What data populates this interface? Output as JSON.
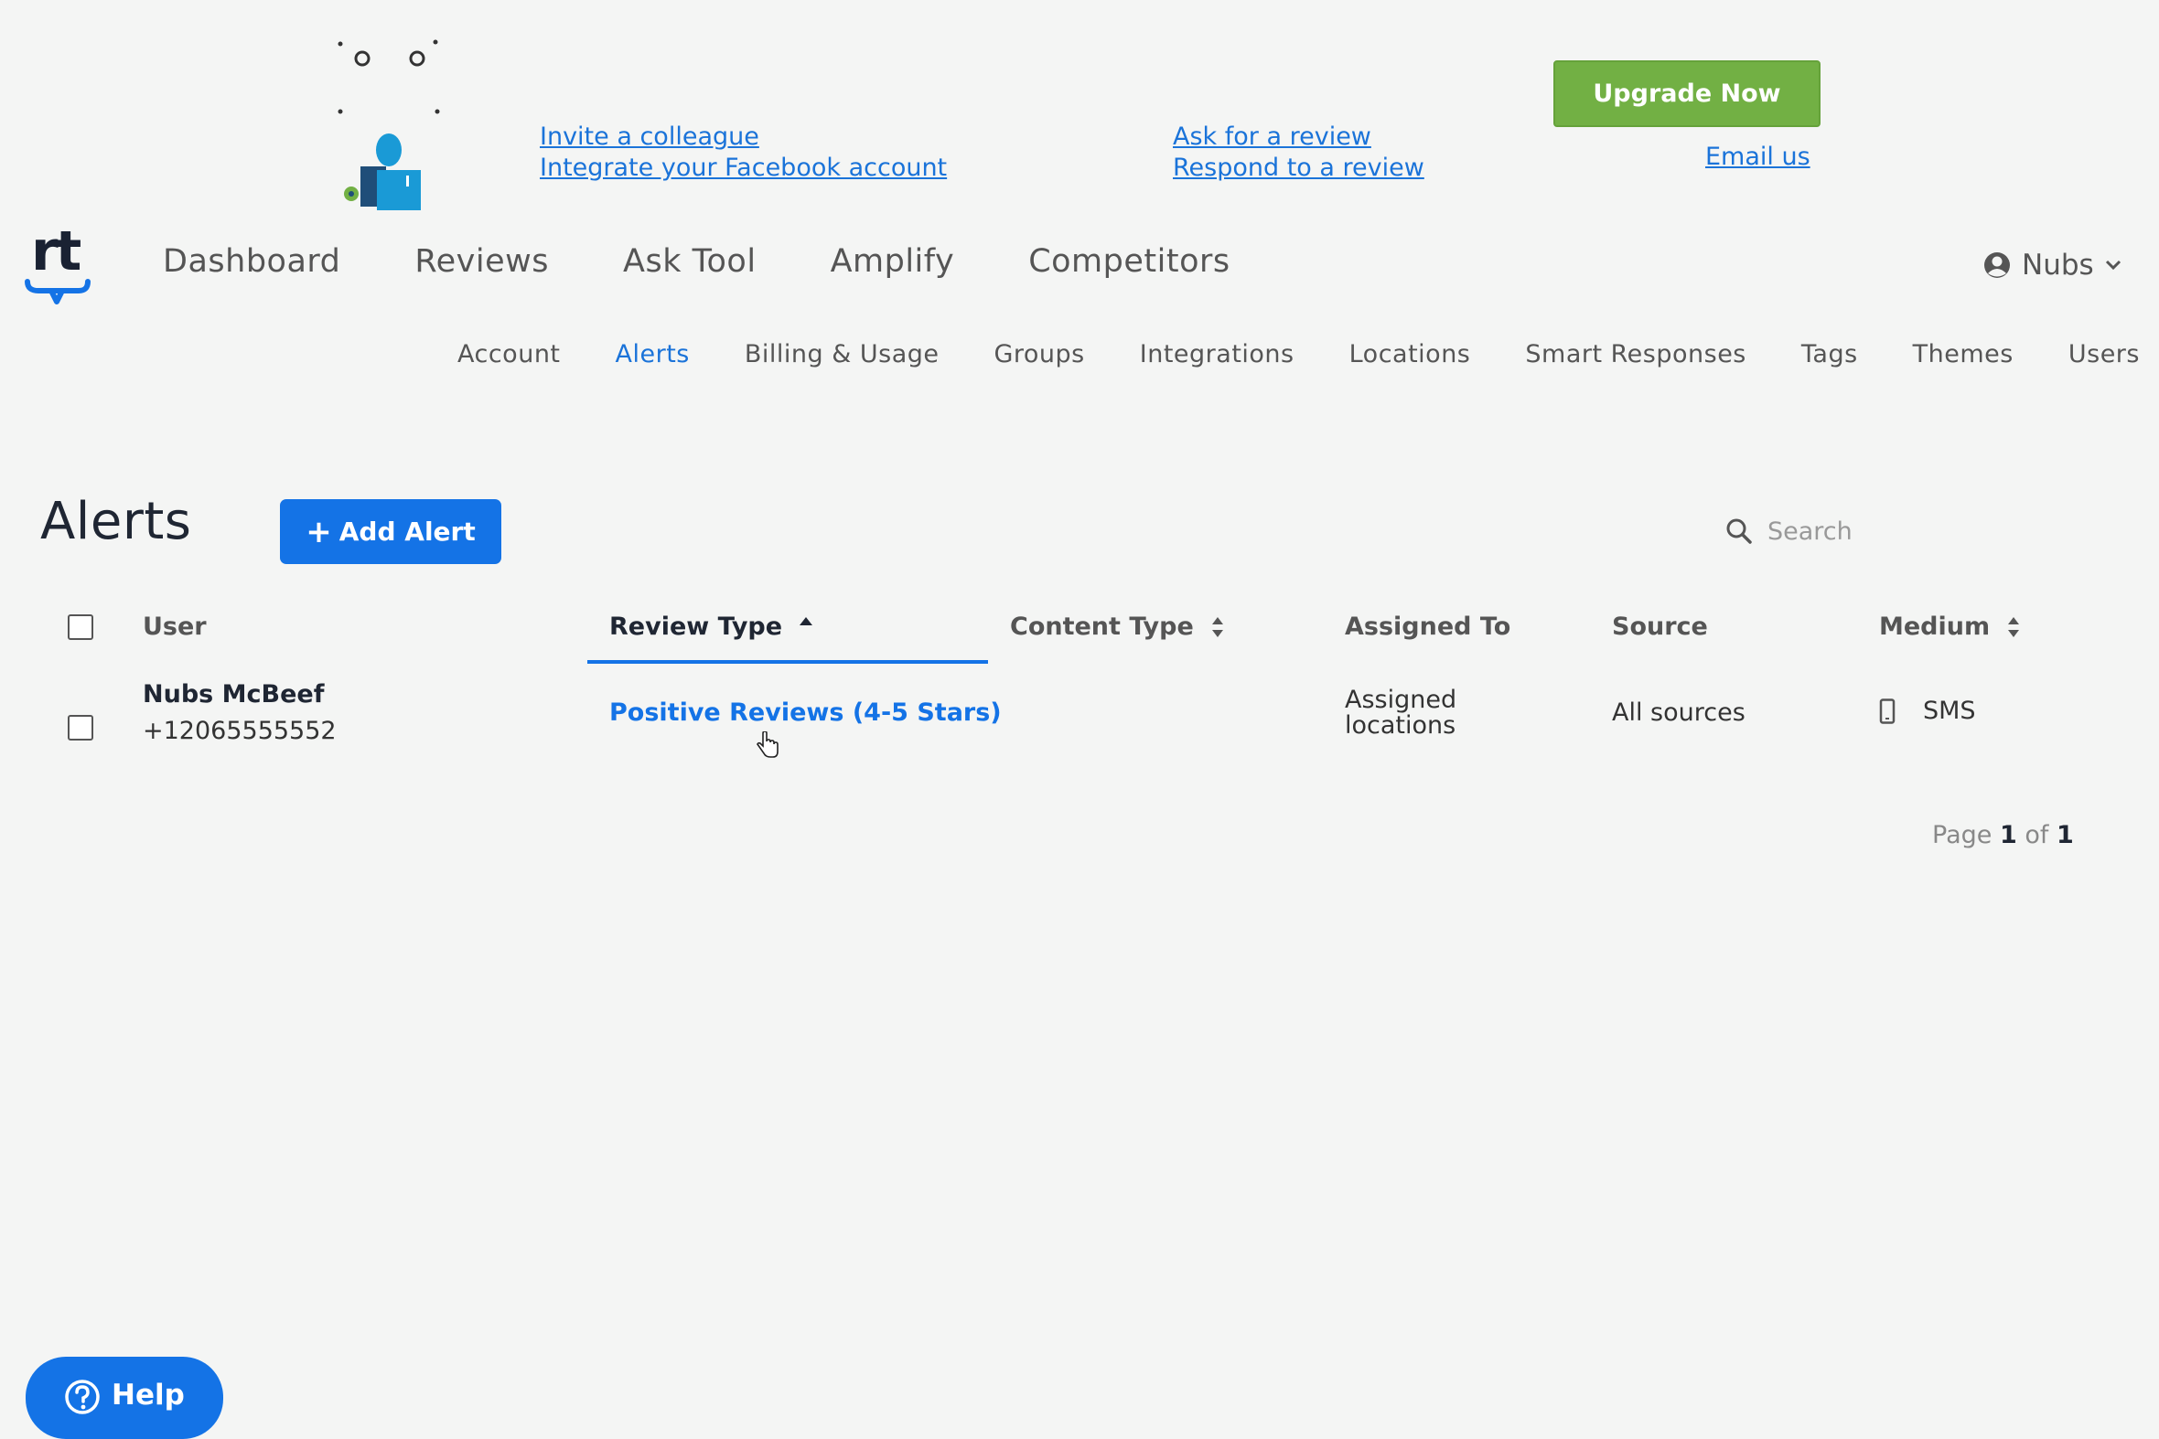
{
  "promo": {
    "left_links": [
      "Invite a colleague",
      "Integrate your Facebook account"
    ],
    "middle_links": [
      "Ask for a review",
      "Respond to a review"
    ],
    "upgrade_label": "Upgrade Now",
    "email_label": "Email us"
  },
  "logo": {
    "text": "rt"
  },
  "main_nav": {
    "items": [
      "Dashboard",
      "Reviews",
      "Ask Tool",
      "Amplify",
      "Competitors"
    ]
  },
  "user_menu": {
    "name": "Nubs"
  },
  "sub_nav": {
    "items": [
      "Account",
      "Alerts",
      "Billing & Usage",
      "Groups",
      "Integrations",
      "Locations",
      "Smart Responses",
      "Tags",
      "Themes",
      "Users"
    ],
    "active": "Alerts"
  },
  "page": {
    "title": "Alerts",
    "add_button_label": "Add Alert",
    "add_button_icon": "+",
    "search_placeholder": "Search"
  },
  "table": {
    "columns": {
      "user": "User",
      "review_type": "Review Type",
      "content_type": "Content Type",
      "assigned_to": "Assigned To",
      "source": "Source",
      "medium": "Medium"
    },
    "sorted_column": "Review Type",
    "rows": [
      {
        "user_name": "Nubs McBeef",
        "user_phone": "+12065555552",
        "review_type": "Positive Reviews (4-5 Stars)",
        "content_type": "",
        "assigned_to_line1": "Assigned",
        "assigned_to_line2": "locations",
        "source": "All sources",
        "medium": "SMS",
        "medium_icon": "mobile-phone-icon"
      }
    ]
  },
  "pagination": {
    "label": "Page",
    "current": "1",
    "separator": "of",
    "total": "1"
  },
  "help": {
    "label": "Help"
  },
  "colors": {
    "accent": "#1473e6",
    "link": "#1a73d9",
    "upgrade": "#72b044",
    "background": "#f4f5f4"
  }
}
